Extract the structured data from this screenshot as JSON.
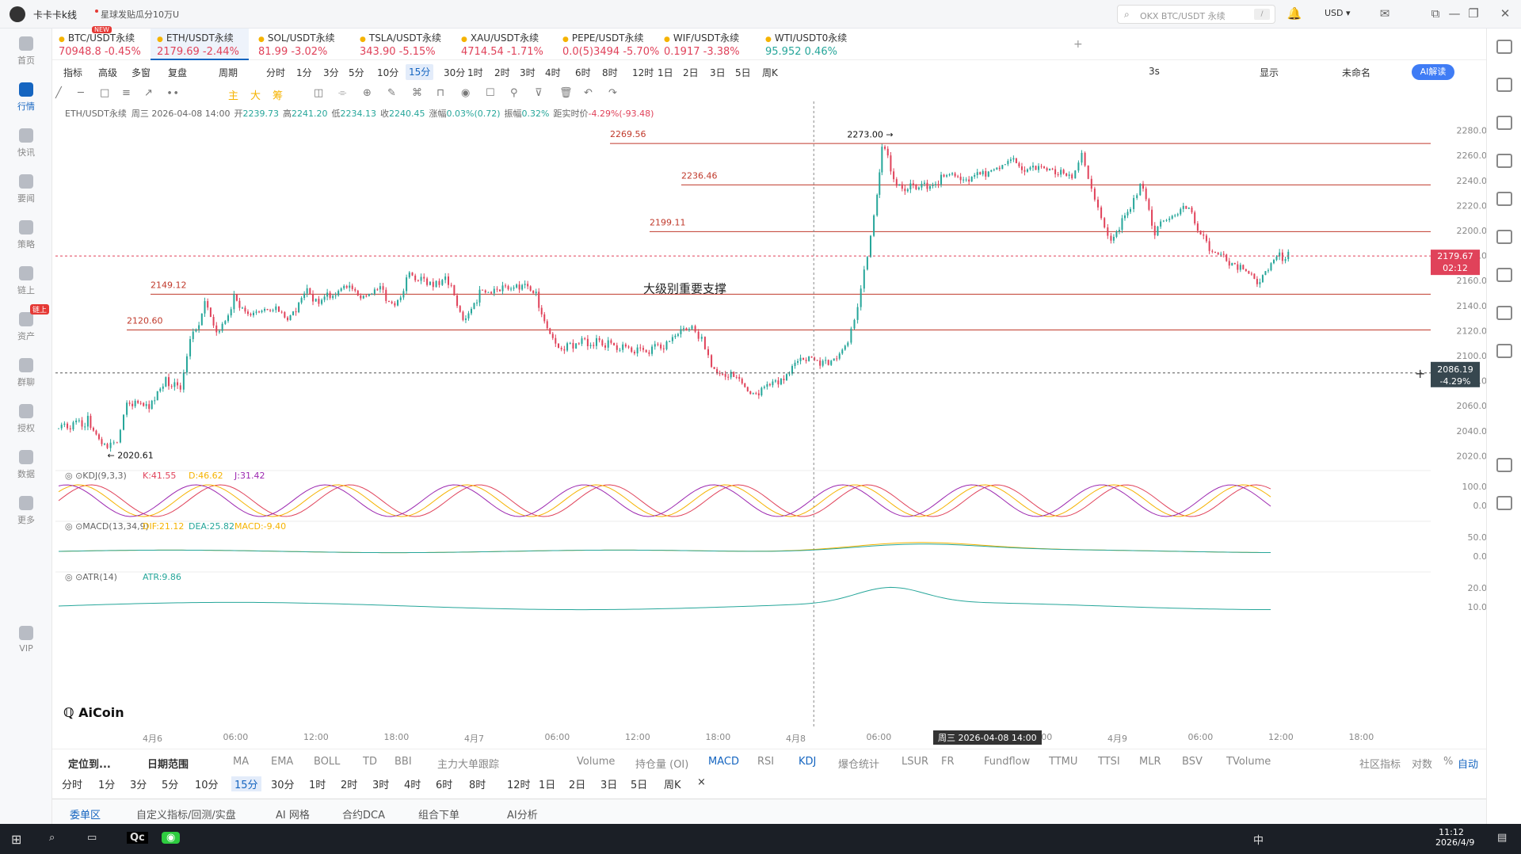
{
  "app": {
    "name": "卡卡卡k线",
    "promo": "星球发贴瓜分10万U"
  },
  "search": {
    "placeholder": "OKX BTC/USDT 永续",
    "hint": "/"
  },
  "header": {
    "currency": "USD"
  },
  "sidebar": [
    {
      "label": "首页"
    },
    {
      "label": "行情",
      "active": true
    },
    {
      "label": "快讯"
    },
    {
      "label": "要闻"
    },
    {
      "label": "策略"
    },
    {
      "label": "链上"
    },
    {
      "label": "资产"
    },
    {
      "label": "群聊"
    },
    {
      "label": "授权"
    },
    {
      "label": "数据"
    },
    {
      "label": "更多"
    },
    {
      "label": "VIP"
    }
  ],
  "chain_badge": "链上",
  "tabs": [
    {
      "name": "BTC/USDT永续",
      "price": "70948.8",
      "change": "-0.45%",
      "dir": "down",
      "badge": "NEW"
    },
    {
      "name": "ETH/USDT永续",
      "price": "2179.69",
      "change": "-2.44%",
      "dir": "down",
      "active": true
    },
    {
      "name": "SOL/USDT永续",
      "price": "81.99",
      "change": "-3.02%",
      "dir": "down"
    },
    {
      "name": "TSLA/USDT永续",
      "price": "343.90",
      "change": "-5.15%",
      "dir": "down"
    },
    {
      "name": "XAU/USDT永续",
      "price": "4714.54",
      "change": "-1.71%",
      "dir": "down"
    },
    {
      "name": "PEPE/USDT永续",
      "price": "0.0(5)3494",
      "change": "-5.70%",
      "dir": "down"
    },
    {
      "name": "WIF/USDT永续",
      "price": "0.1917",
      "change": "-3.38%",
      "dir": "down"
    },
    {
      "name": "WTI/USDT0永续",
      "price": "95.952",
      "change": "0.46%",
      "dir": "up"
    }
  ],
  "toolbar1": {
    "left": [
      "指标",
      "高级",
      "多窗",
      "复盘",
      "周期"
    ],
    "periods": [
      "分时",
      "1分",
      "3分",
      "5分",
      "10分",
      "15分",
      "30分",
      "1时",
      "2时",
      "3时",
      "4时",
      "6时",
      "8时",
      "12时",
      "1日",
      "2日",
      "3日",
      "5日",
      "周K"
    ],
    "selected": "15分",
    "right": [
      "3s",
      "显示",
      "未命名"
    ],
    "ai": "AI解读"
  },
  "toolbar2": {
    "labels": [
      "主",
      "大",
      "筹"
    ]
  },
  "ohlc": {
    "symbol": "ETH/USDT永续",
    "date": "周三 2026-04-08 14:00",
    "open_label": "开",
    "open": "2239.73",
    "high_label": "高",
    "high": "2241.20",
    "low_label": "低",
    "low": "2234.13",
    "close_label": "收",
    "close": "2240.45",
    "chg_label": "涨幅",
    "chg": "0.03%(0.72)",
    "amp_label": "振幅",
    "amp": "0.32%",
    "dist_label": "距实时价",
    "dist": "-4.29%(-93.48)"
  },
  "chart_data": {
    "type": "candlestick",
    "yaxis": {
      "ticks": [
        2280,
        2260,
        2240,
        2220,
        2200,
        2180,
        2160,
        2140,
        2120,
        2100,
        2080,
        2060,
        2040,
        2020
      ],
      "labels": [
        "2280.00",
        "2260.00",
        "2240.00",
        "2220.00",
        "2200.00",
        "2180.00",
        "2160.00",
        "2140.00",
        "2120.00",
        "2100.00",
        "2080.00",
        "2060.00",
        "2040.00",
        "2020.00"
      ],
      "ylim": [
        2012,
        2288
      ]
    },
    "xaxis": [
      "4月6",
      "06:00",
      "12:00",
      "18:00",
      "4月7",
      "06:00",
      "12:00",
      "18:00",
      "4月8",
      "06:00",
      "12:00",
      "18:00",
      "4月9",
      "06:00",
      "12:00",
      "18:00"
    ],
    "levels": [
      {
        "value": 2269.56,
        "label": "2269.56"
      },
      {
        "value": 2236.46,
        "label": "2236.46"
      },
      {
        "value": 2199.11,
        "label": "2199.11"
      },
      {
        "value": 2149.12,
        "label": "2149.12"
      },
      {
        "value": 2120.6,
        "label": "2120.60"
      }
    ],
    "annotation": "大级别重要支撑",
    "high_marker": "2273.00 →",
    "low_marker": "← 2020.61",
    "current_price": "2179.67",
    "countdown": "02:12",
    "cross_price": "2086.19",
    "cross_pct": "-4.29%",
    "cross_time": "周三 2026-04-08 14:00",
    "path": [
      [
        0,
        2042
      ],
      [
        30,
        2048
      ],
      [
        50,
        2025
      ],
      [
        60,
        2030
      ],
      [
        70,
        2065
      ],
      [
        90,
        2058
      ],
      [
        110,
        2082
      ],
      [
        125,
        2070
      ],
      [
        135,
        2110
      ],
      [
        150,
        2140
      ],
      [
        165,
        2118
      ],
      [
        180,
        2145
      ],
      [
        200,
        2132
      ],
      [
        220,
        2138
      ],
      [
        235,
        2130
      ],
      [
        255,
        2150
      ],
      [
        270,
        2143
      ],
      [
        290,
        2155
      ],
      [
        310,
        2148
      ],
      [
        330,
        2152
      ],
      [
        345,
        2138
      ],
      [
        360,
        2165
      ],
      [
        375,
        2158
      ],
      [
        400,
        2160
      ],
      [
        415,
        2130
      ],
      [
        435,
        2152
      ],
      [
        450,
        2150
      ],
      [
        470,
        2158
      ],
      [
        490,
        2148
      ],
      [
        510,
        2106
      ],
      [
        540,
        2112
      ],
      [
        570,
        2108
      ],
      [
        600,
        2102
      ],
      [
        630,
        2112
      ],
      [
        650,
        2125
      ],
      [
        660,
        2112
      ],
      [
        670,
        2090
      ],
      [
        690,
        2085
      ],
      [
        710,
        2070
      ],
      [
        730,
        2075
      ],
      [
        750,
        2088
      ],
      [
        770,
        2100
      ],
      [
        790,
        2092
      ],
      [
        810,
        2112
      ],
      [
        820,
        2135
      ],
      [
        830,
        2180
      ],
      [
        840,
        2230
      ],
      [
        845,
        2270
      ],
      [
        860,
        2238
      ],
      [
        880,
        2232
      ],
      [
        900,
        2240
      ],
      [
        920,
        2245
      ],
      [
        940,
        2242
      ],
      [
        960,
        2250
      ],
      [
        980,
        2255
      ],
      [
        1000,
        2248
      ],
      [
        1020,
        2250
      ],
      [
        1040,
        2240
      ],
      [
        1050,
        2265
      ],
      [
        1060,
        2230
      ],
      [
        1070,
        2208
      ],
      [
        1080,
        2195
      ],
      [
        1100,
        2215
      ],
      [
        1110,
        2238
      ],
      [
        1125,
        2200
      ],
      [
        1140,
        2212
      ],
      [
        1160,
        2218
      ],
      [
        1175,
        2192
      ],
      [
        1190,
        2180
      ],
      [
        1210,
        2172
      ],
      [
        1230,
        2160
      ],
      [
        1250,
        2178
      ],
      [
        1265,
        2181
      ]
    ],
    "kdj": {
      "label": "KDJ(9,3,3)",
      "K": "K:41.55",
      "D": "D:46.62",
      "J": "J:31.42",
      "ticks": [
        "100.00",
        "0.00"
      ]
    },
    "macd": {
      "label": "MACD(13,34,9)",
      "DIF": "DIF:21.12",
      "DEA": "DEA:25.82",
      "MACD": "MACD:-9.40",
      "ticks": [
        "50.00",
        "0.00"
      ]
    },
    "atr": {
      "label": "ATR(14)",
      "ATR": "ATR:9.86",
      "ticks": [
        "20.00",
        "10.00"
      ]
    }
  },
  "watermark": "AiCoin",
  "indicator_bar": {
    "left": [
      "定位到...",
      "日期范围"
    ],
    "main": [
      "MA",
      "EMA",
      "BOLL",
      "TD",
      "BBI",
      "主力大单跟踪"
    ],
    "sub": [
      "Volume",
      "持仓量 (OI)",
      "MACD",
      "RSI",
      "KDJ",
      "爆仓统计",
      "LSUR",
      "FR",
      "Fundflow",
      "TTMU",
      "TTSI",
      "MLR",
      "BSV",
      "TVolume"
    ],
    "right": [
      "社区指标",
      "对数",
      "%",
      "自动"
    ]
  },
  "period_bar": [
    "分时",
    "1分",
    "3分",
    "5分",
    "10分",
    "15分",
    "30分",
    "1时",
    "2时",
    "3时",
    "4时",
    "6时",
    "8时",
    "12时",
    "1日",
    "2日",
    "3日",
    "5日",
    "周K",
    "×"
  ],
  "bottom_tabs": [
    "委单区",
    "自定义指标/回测/实盘",
    "AI 网格",
    "合约DCA",
    "组合下单",
    "AI分析"
  ],
  "taskbar": {
    "time": "11:12",
    "date": "2026/4/9",
    "ime": "中"
  },
  "colors": {
    "up": "#26a69a",
    "down": "#e0425a",
    "accent": "#1565c0",
    "level": "#c0392b"
  }
}
